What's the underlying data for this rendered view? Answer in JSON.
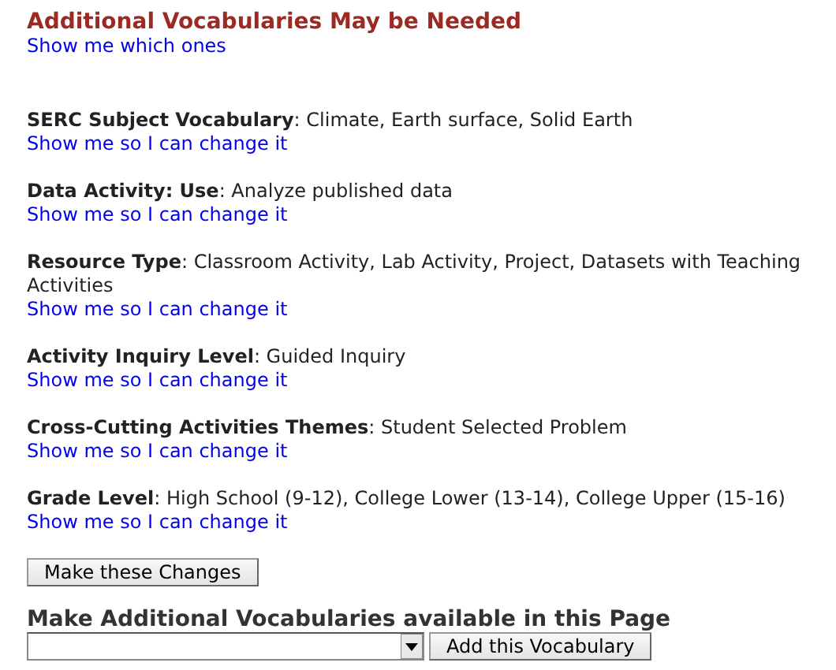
{
  "notice": {
    "title": "Additional Vocabularies May be Needed",
    "link": "Show me which ones"
  },
  "vocabularies": [
    {
      "text": "**SERC Subject Vocabulary**: Climate, Earth surface, Solid Earth",
      "link": "Show me so I can change it"
    },
    {
      "text": "**Data Activity: Use**: Analyze published data",
      "link": "Show me so I can change it"
    },
    {
      "text": "**Resource Type**: Classroom Activity, Lab Activity, Project, Datasets with Teaching Activities",
      "link": "Show me so I can change it"
    },
    {
      "text": "**Activity Inquiry Level**: Guided Inquiry",
      "link": "Show me so I can change it"
    },
    {
      "text": "**Cross-Cutting Activities Themes**: Student Selected Problem",
      "link": "Show me so I can change it"
    },
    {
      "text": "**Grade Level**: High School (9-12), College Lower (13-14), College Upper (15-16)",
      "link": "Show me so I can change it"
    }
  ],
  "submit_button": "Make these Changes",
  "add_section": {
    "heading": "Make Additional Vocabularies available in this Page",
    "button": "Add this Vocabulary"
  }
}
